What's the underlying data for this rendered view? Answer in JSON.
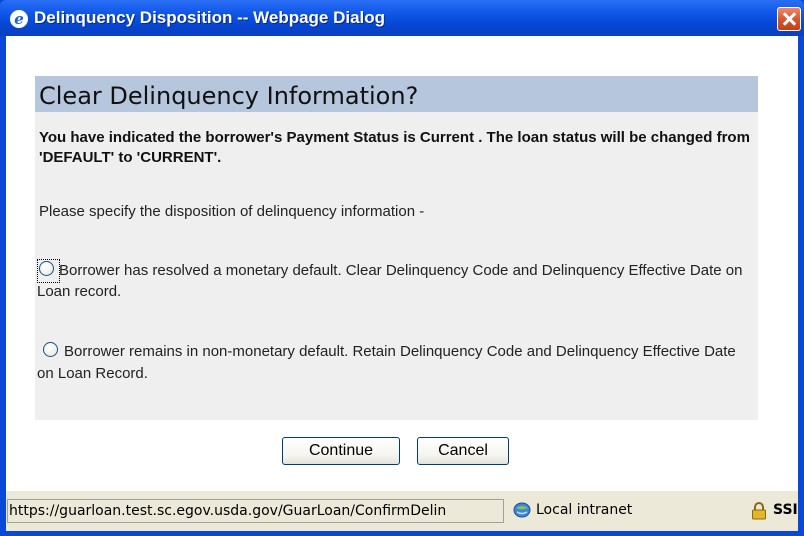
{
  "window": {
    "title": "Delinquency Disposition -- Webpage Dialog",
    "browser_icon_glyph": "e"
  },
  "dialog": {
    "heading": "Clear Delinquency Information?",
    "message": "You have indicated the borrower's Payment Status is Current . The loan status will be changed from 'DEFAULT' to 'CURRENT'.",
    "instruction": "Please specify the disposition of delinquency information -",
    "options": [
      {
        "label": "Borrower has resolved a monetary default. Clear Delinquency Code and Delinquency Effective Date on Loan record.",
        "selected": false,
        "focused": true
      },
      {
        "label": "Borrower remains in non-monetary default. Retain Delinquency Code and Delinquency Effective Date on Loan Record.",
        "selected": false,
        "focused": false
      }
    ],
    "buttons": {
      "continue_label": "Continue",
      "cancel_label": "Cancel"
    }
  },
  "statusbar": {
    "url": "https://guarloan.test.sc.egov.usda.gov/GuarLoan/ConfirmDelin",
    "zone": "Local intranet",
    "security": "SSI"
  },
  "icons": {
    "browser": "ie-icon",
    "close": "close-icon",
    "zone": "local-intranet-icon",
    "security": "lock-icon"
  },
  "colors": {
    "titlebar": "#0646d3",
    "header_bar": "#b6c6dc",
    "panel": "#efefef",
    "close": "#d8582e"
  }
}
